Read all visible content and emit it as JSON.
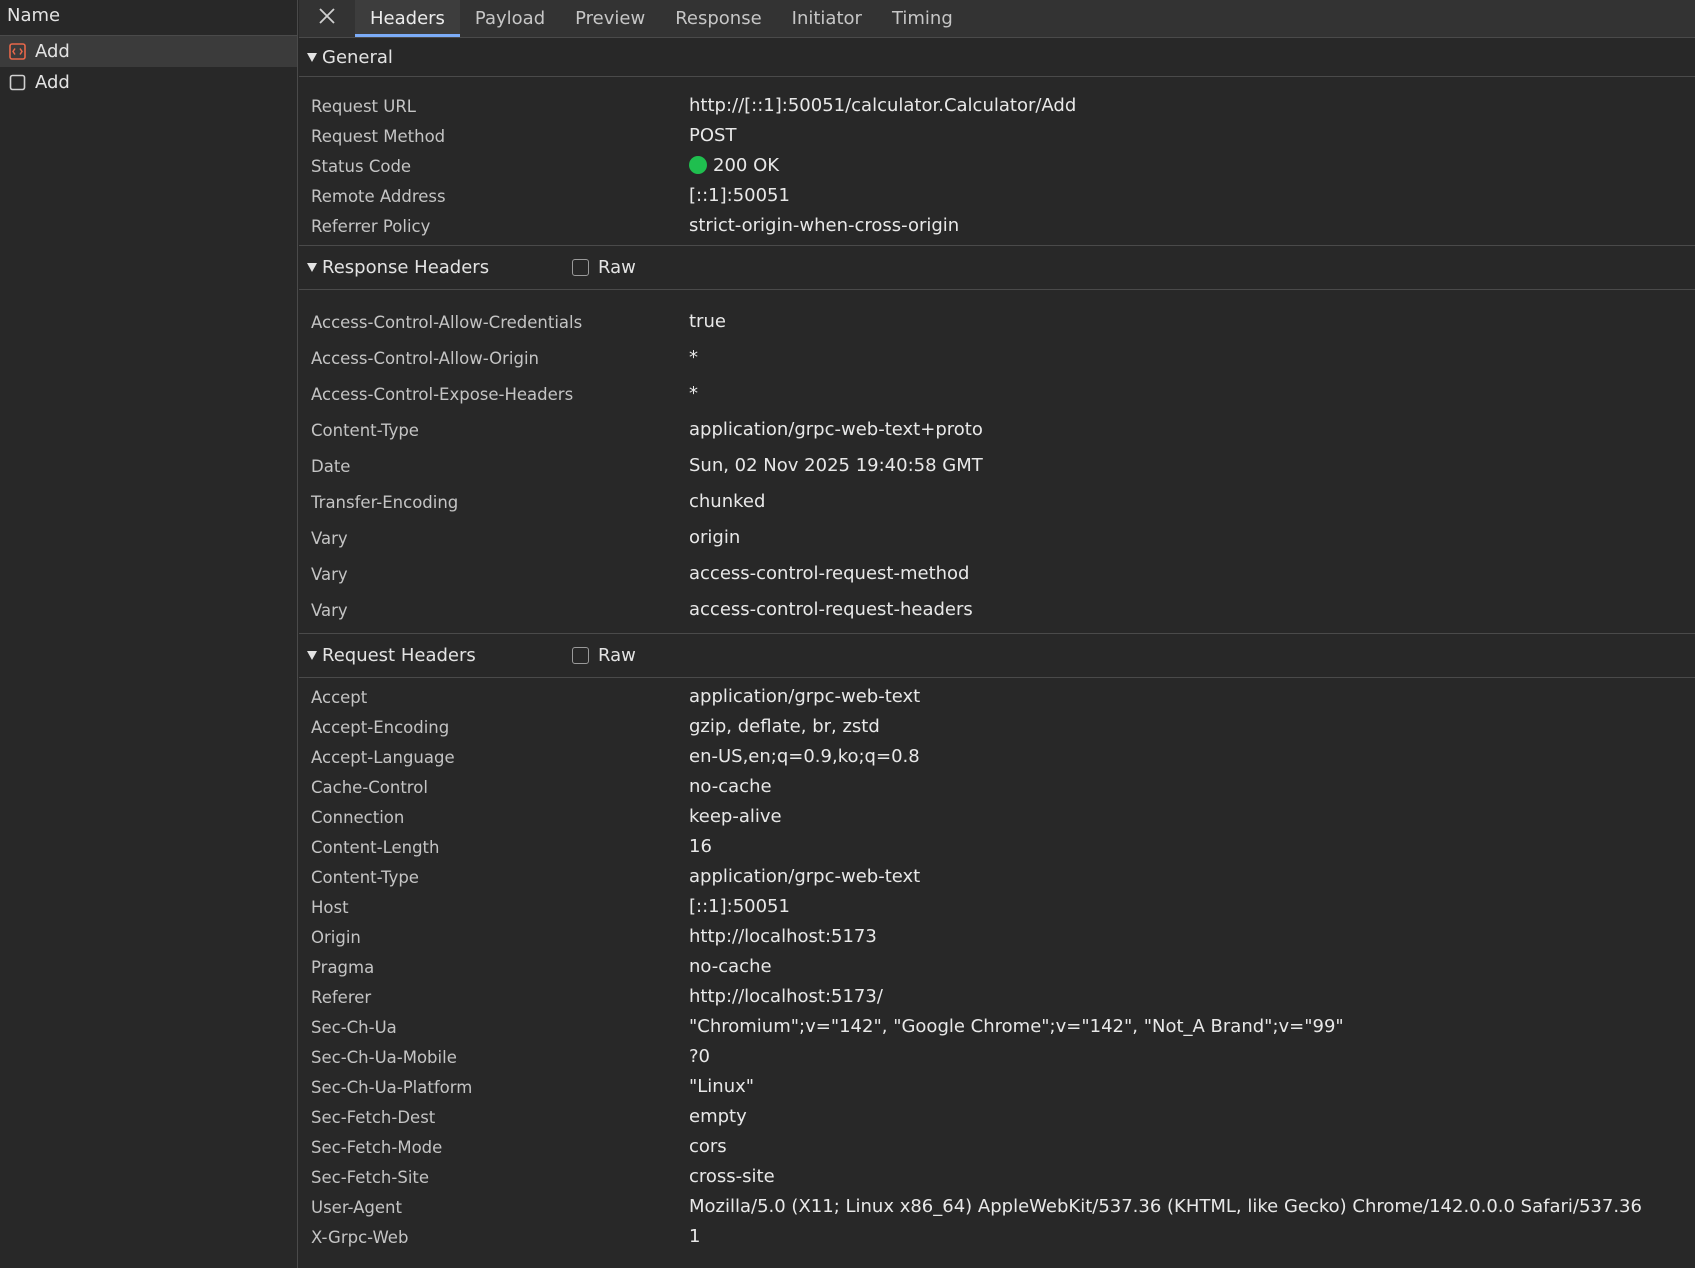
{
  "left_panel": {
    "header": "Name",
    "requests": [
      {
        "name": "Add",
        "icon": "grpc-request-icon",
        "selected": true
      },
      {
        "name": "Add",
        "icon": "checkbox-icon",
        "selected": false
      }
    ]
  },
  "tabs": {
    "close_icon": "close-icon",
    "items": [
      "Headers",
      "Payload",
      "Preview",
      "Response",
      "Initiator",
      "Timing"
    ],
    "active": "Headers"
  },
  "general": {
    "title": "General",
    "rows": [
      {
        "key": "Request URL",
        "value": "http://[::1]:50051/calculator.Calculator/Add"
      },
      {
        "key": "Request Method",
        "value": "POST"
      },
      {
        "key": "Status Code",
        "value": "200 OK"
      },
      {
        "key": "Remote Address",
        "value": "[::1]:50051"
      },
      {
        "key": "Referrer Policy",
        "value": "strict-origin-when-cross-origin"
      }
    ]
  },
  "response_headers": {
    "title": "Response Headers",
    "raw_label": "Raw",
    "rows": [
      {
        "key": "Access-Control-Allow-Credentials",
        "value": "true"
      },
      {
        "key": "Access-Control-Allow-Origin",
        "value": "*"
      },
      {
        "key": "Access-Control-Expose-Headers",
        "value": "*"
      },
      {
        "key": "Content-Type",
        "value": "application/grpc-web-text+proto"
      },
      {
        "key": "Date",
        "value": "Sun, 02 Nov 2025 19:40:58 GMT"
      },
      {
        "key": "Transfer-Encoding",
        "value": "chunked"
      },
      {
        "key": "Vary",
        "value": "origin"
      },
      {
        "key": "Vary",
        "value": "access-control-request-method"
      },
      {
        "key": "Vary",
        "value": "access-control-request-headers"
      }
    ]
  },
  "request_headers": {
    "title": "Request Headers",
    "raw_label": "Raw",
    "rows": [
      {
        "key": "Accept",
        "value": "application/grpc-web-text"
      },
      {
        "key": "Accept-Encoding",
        "value": "gzip, deflate, br, zstd"
      },
      {
        "key": "Accept-Language",
        "value": "en-US,en;q=0.9,ko;q=0.8"
      },
      {
        "key": "Cache-Control",
        "value": "no-cache"
      },
      {
        "key": "Connection",
        "value": "keep-alive"
      },
      {
        "key": "Content-Length",
        "value": "16"
      },
      {
        "key": "Content-Type",
        "value": "application/grpc-web-text"
      },
      {
        "key": "Host",
        "value": "[::1]:50051"
      },
      {
        "key": "Origin",
        "value": "http://localhost:5173"
      },
      {
        "key": "Pragma",
        "value": "no-cache"
      },
      {
        "key": "Referer",
        "value": "http://localhost:5173/"
      },
      {
        "key": "Sec-Ch-Ua",
        "value": "\"Chromium\";v=\"142\", \"Google Chrome\";v=\"142\", \"Not_A Brand\";v=\"99\""
      },
      {
        "key": "Sec-Ch-Ua-Mobile",
        "value": "?0"
      },
      {
        "key": "Sec-Ch-Ua-Platform",
        "value": "\"Linux\""
      },
      {
        "key": "Sec-Fetch-Dest",
        "value": "empty"
      },
      {
        "key": "Sec-Fetch-Mode",
        "value": "cors"
      },
      {
        "key": "Sec-Fetch-Site",
        "value": "cross-site"
      },
      {
        "key": "User-Agent",
        "value": "Mozilla/5.0 (X11; Linux x86_64) AppleWebKit/537.36 (KHTML, like Gecko) Chrome/142.0.0.0 Safari/537.36"
      },
      {
        "key": "X-Grpc-Web",
        "value": "1"
      }
    ]
  },
  "colors": {
    "status_ok": "#1fbf4f",
    "tab_active_underline": "#7cacf8",
    "grpc_icon": "#e8684a"
  }
}
